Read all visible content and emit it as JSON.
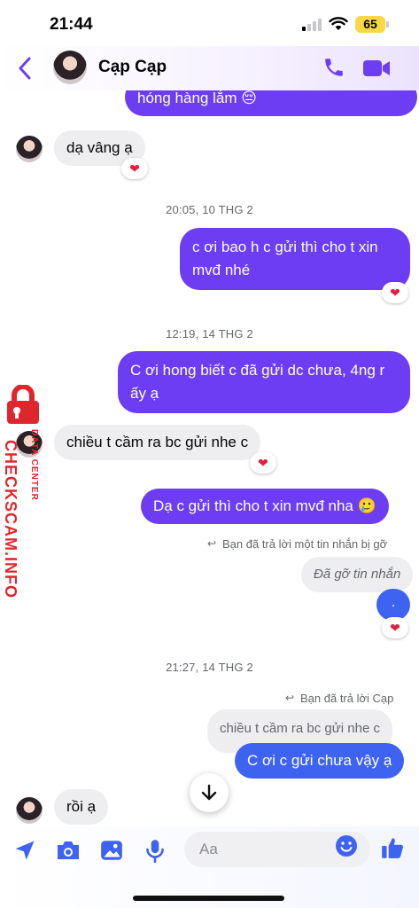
{
  "status_bar": {
    "time": "21:44",
    "battery": "65"
  },
  "header": {
    "contact_name": "Cạp Cạp"
  },
  "watermark": {
    "brand": "CHECKSCAM.INFO",
    "subtitle": "DATA CENTER"
  },
  "messages": [
    {
      "kind": "out",
      "text": "hóng hàng lắm 😔"
    },
    {
      "kind": "in",
      "text": "dạ vâng ạ",
      "reaction": "❤"
    },
    {
      "kind": "timestamp",
      "text": "20:05, 10 THG 2"
    },
    {
      "kind": "out",
      "text": "c ơi bao h c gửi thì cho t xin mvđ nhé",
      "reaction": "❤"
    },
    {
      "kind": "timestamp",
      "text": "12:19, 14 THG 2"
    },
    {
      "kind": "out",
      "text": "C ơi hong biết c đã gửi dc chưa, 4ng r ấy ạ"
    },
    {
      "kind": "in",
      "text": "chiều t cầm ra bc gửi nhe c",
      "reaction": "❤"
    },
    {
      "kind": "out",
      "text": "Dạ c gửi thì cho t xin mvđ nha 🥲"
    },
    {
      "kind": "reply_note",
      "text": "Bạn đã trả lời một tin nhắn bị gỡ"
    },
    {
      "kind": "quoted",
      "text": "Đã gỡ tin nhắn"
    },
    {
      "kind": "out",
      "text": ".",
      "reaction": "❤"
    },
    {
      "kind": "timestamp",
      "text": "21:27, 14 THG 2"
    },
    {
      "kind": "reply_note",
      "text": "Bạn đã trả lời Cạp"
    },
    {
      "kind": "quoted",
      "text": "chiều t cầm ra bc gửi nhe c"
    },
    {
      "kind": "out",
      "text": "C ơi c gửi chưa vậy ạ"
    },
    {
      "kind": "in",
      "text": "rồi ạ"
    }
  ],
  "composer": {
    "placeholder": "Aa"
  },
  "colors": {
    "accent": "#6c3df2",
    "outgoing_latest": "#3e63f0",
    "incoming": "#eeeef0",
    "reaction_heart": "#e41e3f"
  },
  "icons": [
    "chevron-left-icon",
    "phone-icon",
    "video-camera-icon",
    "arrow-down-icon",
    "location-arrow-icon",
    "camera-icon",
    "image-icon",
    "microphone-icon",
    "smile-emoji-icon",
    "thumbs-up-icon",
    "lock-icon"
  ]
}
